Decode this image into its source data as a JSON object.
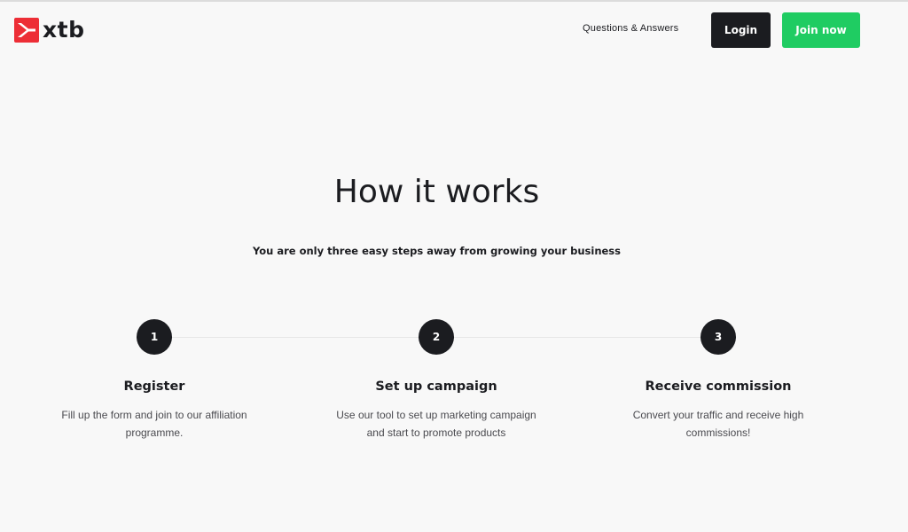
{
  "colors": {
    "brand_red": "#ed2e36",
    "dark": "#1b1c20",
    "green": "#1fcc62",
    "background": "#f8f8f8"
  },
  "header": {
    "logo_icon": "xtb-logo-icon",
    "logo_text": "xtb",
    "nav_link": "Questions & Answers",
    "login_label": "Login",
    "join_label": "Join now"
  },
  "main": {
    "title": "How it works",
    "subtitle": "You are only three easy steps away from growing your business",
    "steps": [
      {
        "number": "1",
        "title": "Register",
        "desc_line1": "Fill up the form and join to our affiliation",
        "desc_line2": "programme."
      },
      {
        "number": "2",
        "title": "Set up campaign",
        "desc_line1": "Use our tool to set up marketing campaign",
        "desc_line2": "and start to promote products"
      },
      {
        "number": "3",
        "title": "Receive commission",
        "desc_line1": "Convert your traffic and receive high",
        "desc_line2": "commissions!"
      }
    ]
  }
}
